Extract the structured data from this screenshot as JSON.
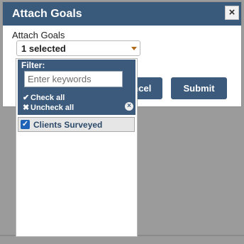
{
  "dialog": {
    "title": "Attach Goals",
    "close_glyph": "×",
    "field_label": "Attach Goals",
    "select_value": "1 selected",
    "cancel_label": "Cancel",
    "submit_label": "Submit"
  },
  "dropdown": {
    "filter_label": "Filter:",
    "filter_value": "",
    "filter_placeholder": "Enter keywords",
    "check_all_label": "Check all",
    "check_all_icon": "✔",
    "uncheck_all_label": "Uncheck all",
    "uncheck_all_icon": "✖",
    "clear_icon": "×",
    "options": [
      {
        "label": "Clients Surveyed",
        "checked": true,
        "check_glyph": "✓"
      }
    ]
  },
  "colors": {
    "header": "#3a5a7c",
    "button": "#3b5a7c",
    "checkbox": "#1e63b8",
    "backdrop": "#9b9b9b"
  },
  "icons": {
    "close": "close-icon",
    "dropdown_arrow": "chevron-down-icon",
    "check_all": "checkmark-icon",
    "uncheck_all": "x-icon",
    "clear_filter": "clear-icon",
    "option_checkbox": "checkbox-checked-icon"
  }
}
